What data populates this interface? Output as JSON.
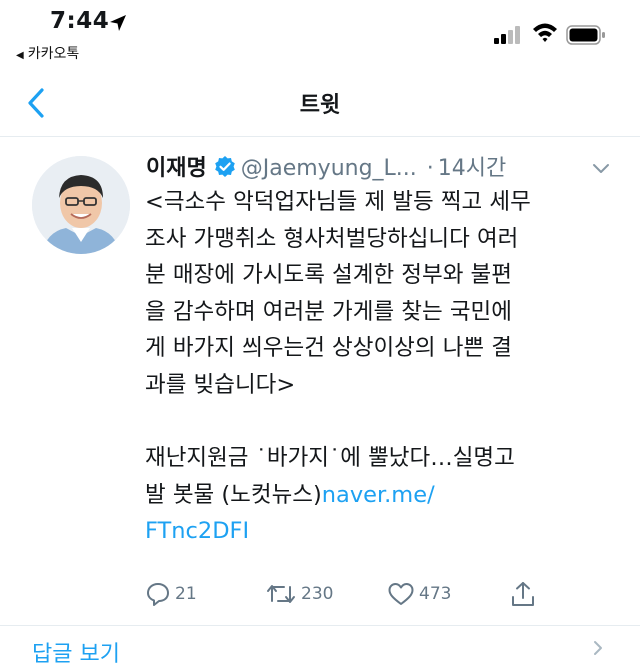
{
  "status_bar": {
    "time": "7:44",
    "back_app": "카카오톡",
    "location_icon": "location-arrow-icon",
    "signal_icon": "cellular-signal-icon",
    "wifi_icon": "wifi-icon",
    "battery_icon": "battery-icon"
  },
  "nav": {
    "title": "트윗",
    "back_icon": "chevron-left-icon"
  },
  "tweet": {
    "author_name": "이재명",
    "verified_icon": "verified-badge-icon",
    "handle": "@Jaemyung_L...",
    "separator": "·",
    "time_ago": "14시간",
    "lines": [
      "<극소수 악덕업자님들 제 발등 찍고 세무",
      "조사 가맹취소 형사처벌당하십니다 여러",
      "분 매장에 가시도록 설계한 정부와 불편",
      "을 감수하며 여러분 가게를 찾는 국민에",
      "게 바가지 씌우는건 상상이상의 나쁜 결",
      "과를 빚습니다>"
    ],
    "headline_line1": "재난지원금 ˙바가지˙에 뿔났다…실명고",
    "headline_line2_text": "발 봇물 (노컷뉴스)",
    "link_part1": "naver.me/",
    "link_part2": "FTnc2DFI"
  },
  "actions": {
    "reply_count": "21",
    "retweet_count": "230",
    "like_count": "473",
    "reply_icon": "reply-bubble-icon",
    "retweet_icon": "retweet-icon",
    "like_icon": "heart-icon",
    "share_icon": "share-icon"
  },
  "more_text": "답글 보기",
  "colors": {
    "accent": "#1da1f2",
    "muted": "#657786",
    "text": "#14171a",
    "divider": "#e6ecf0"
  }
}
